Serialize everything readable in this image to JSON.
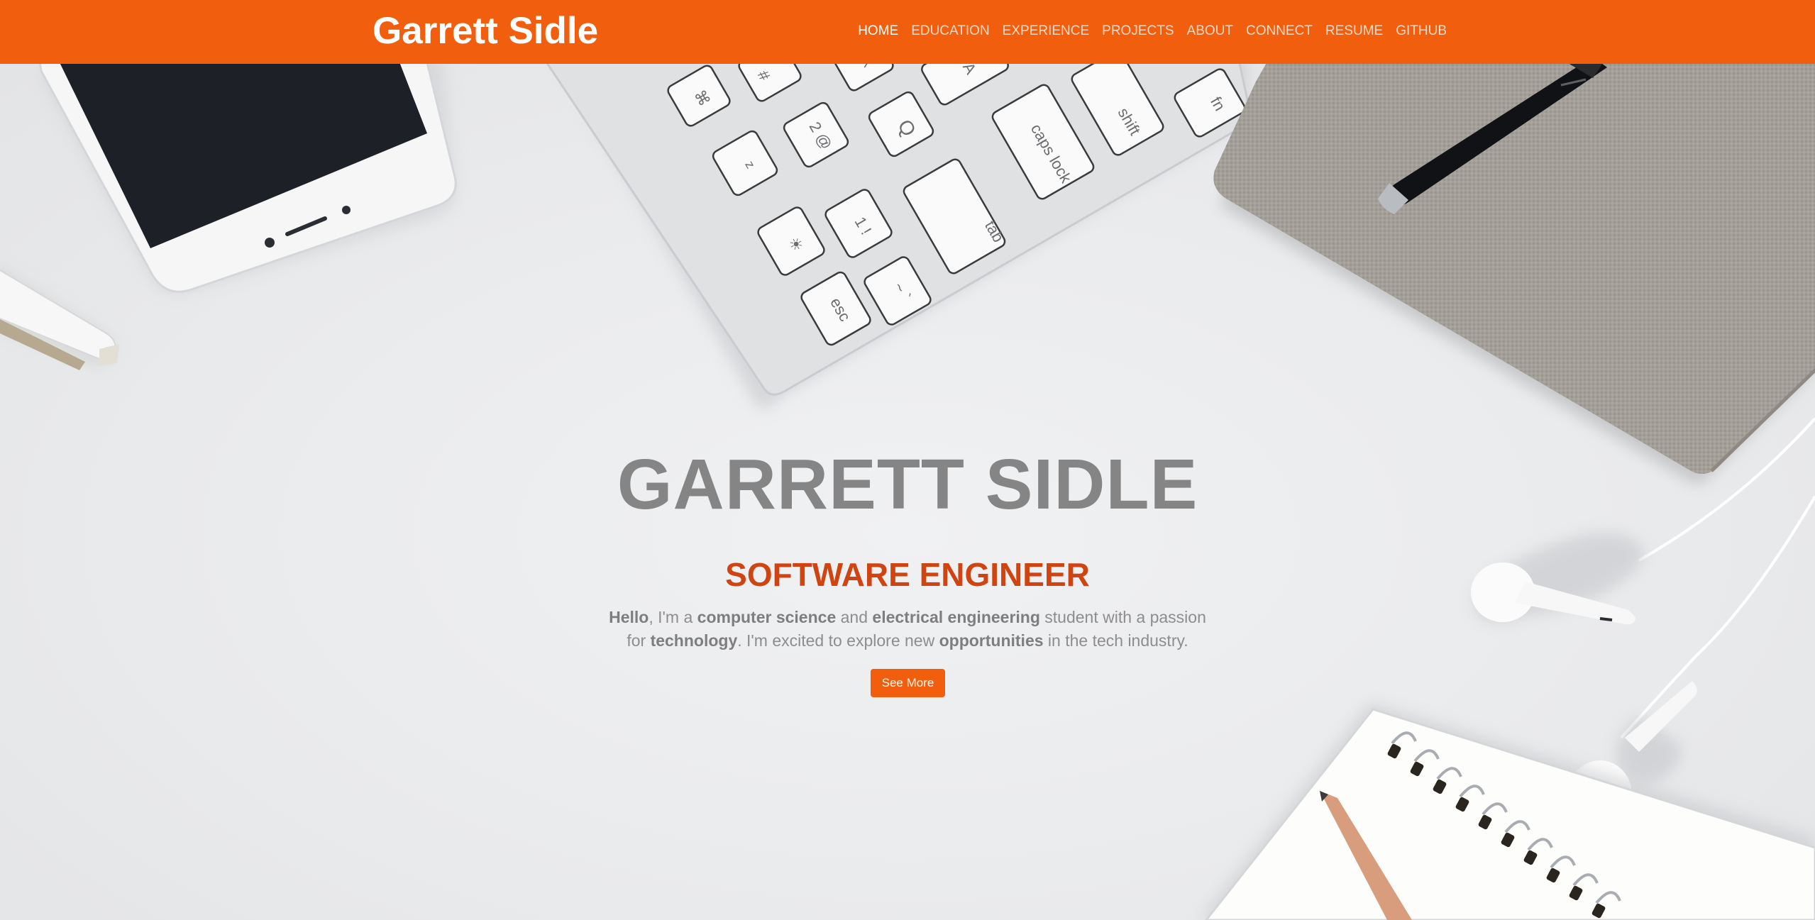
{
  "navbar": {
    "brand": "Garrett Sidle",
    "links": [
      {
        "label": "HOME",
        "active": true
      },
      {
        "label": "EDUCATION",
        "active": false
      },
      {
        "label": "EXPERIENCE",
        "active": false
      },
      {
        "label": "PROJECTS",
        "active": false
      },
      {
        "label": "ABOUT",
        "active": false
      },
      {
        "label": "CONNECT",
        "active": false
      },
      {
        "label": "RESUME",
        "active": false
      },
      {
        "label": "GITHUB",
        "active": false
      }
    ]
  },
  "hero": {
    "title": "GARRETT SIDLE",
    "subtitle": "SOFTWARE ENGINEER",
    "intro": {
      "w1": "Hello",
      "t1": ", I'm a ",
      "w2": "computer science",
      "t2": " and ",
      "w3": "electrical engineering",
      "t3": " student with a passion for ",
      "w4": "technology",
      "t4": ". I'm excited to explore new ",
      "w5": "opportunities",
      "t5": " in the tech industry."
    },
    "button_label": "See More"
  },
  "background_keys": {
    "row1": [
      "⌘",
      "#",
      "^",
      "A"
    ],
    "row2": [
      "z",
      "2 @",
      "Q",
      "caps lock",
      "shift",
      "fn"
    ],
    "row3": [
      "☀",
      "1 !",
      "tab"
    ],
    "row4": [
      "esc",
      "~ `"
    ]
  },
  "colors": {
    "accent": "#f15e0e",
    "subtitle": "#cf4411",
    "title_gray": "#858585",
    "text_gray": "#8d8d8d",
    "background": "#eceef0"
  }
}
